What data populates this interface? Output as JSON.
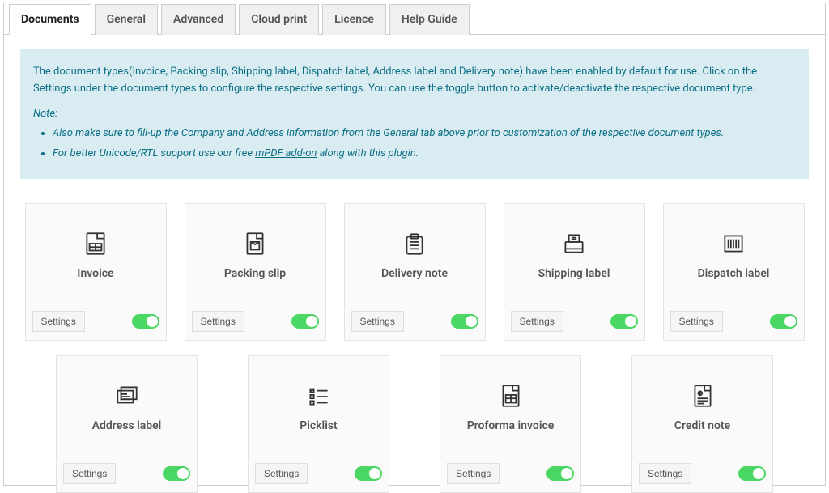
{
  "tabs": [
    {
      "label": "Documents",
      "active": true
    },
    {
      "label": "General",
      "active": false
    },
    {
      "label": "Advanced",
      "active": false
    },
    {
      "label": "Cloud print",
      "active": false
    },
    {
      "label": "Licence",
      "active": false
    },
    {
      "label": "Help Guide",
      "active": false
    }
  ],
  "notice": {
    "intro": "The document types(Invoice, Packing slip, Shipping label, Dispatch label, Address label and Delivery note) have been enabled by default for use. Click on the Settings under the document types to configure the respective settings. You can use the toggle button to activate/deactivate the respective document type.",
    "note_label": "Note:",
    "bullets": [
      "Also make sure to fill-up the Company and Address information from the General tab above prior to customization of the respective document types.",
      "For better Unicode/RTL support use our free "
    ],
    "addon_link": "mPDF add-on",
    "addon_suffix": " along with this plugin."
  },
  "settings_label": "Settings",
  "cards_row1": [
    {
      "name": "invoice",
      "label": "Invoice",
      "enabled": true
    },
    {
      "name": "packing-slip",
      "label": "Packing slip",
      "enabled": true
    },
    {
      "name": "delivery-note",
      "label": "Delivery note",
      "enabled": true
    },
    {
      "name": "shipping-label",
      "label": "Shipping label",
      "enabled": true
    },
    {
      "name": "dispatch-label",
      "label": "Dispatch label",
      "enabled": true
    }
  ],
  "cards_row2": [
    {
      "name": "address-label",
      "label": "Address label",
      "enabled": true
    },
    {
      "name": "picklist",
      "label": "Picklist",
      "enabled": true
    },
    {
      "name": "proforma-invoice",
      "label": "Proforma invoice",
      "enabled": true
    },
    {
      "name": "credit-note",
      "label": "Credit note",
      "enabled": true
    }
  ]
}
